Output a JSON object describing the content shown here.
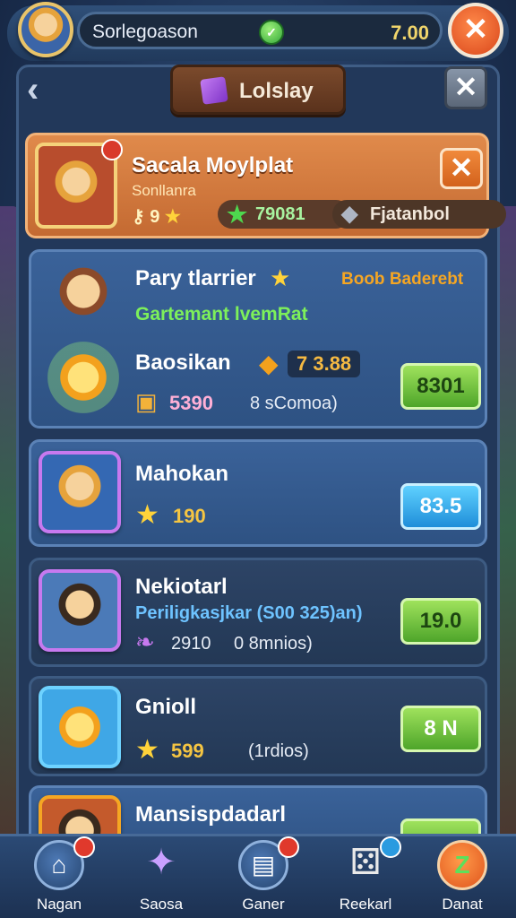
{
  "topbar": {
    "player_name": "Sorlegoason",
    "currency_value": "7.00"
  },
  "header": {
    "title": "Lolslay"
  },
  "featured": {
    "title": "Sacala Moylplat",
    "subtitle": "Sonllanra",
    "stat_left": "9",
    "stat_mid": "79081",
    "stat_right": "Fjatanbol"
  },
  "items": [
    {
      "name": "Pary tlarrier",
      "tag": "Boob Baderebt",
      "subtitle": "Gartemant lvemRat",
      "reward_name": "Baosikan",
      "reward_value": "7 3.88",
      "stat": "5390",
      "note": "8 sComoa)",
      "price": "8301"
    },
    {
      "name": "Mahokan",
      "stat": "190",
      "price": "83.5"
    },
    {
      "name": "Nekiotarl",
      "subtitle": "Periligkasjkar (S00 325)an)",
      "stat": "2910",
      "note": "0  8mnios)",
      "price": "19.0"
    },
    {
      "name": "Gnioll",
      "stat": "599",
      "note": "(1rdios)",
      "price": "8 N"
    },
    {
      "name": "Mansispdadarl",
      "price": ""
    }
  ],
  "nav": [
    {
      "label": "Nagan",
      "icon": "home-icon"
    },
    {
      "label": "Saosa",
      "icon": "stars-icon"
    },
    {
      "label": "Ganer",
      "icon": "game-icon"
    },
    {
      "label": "Reekarl",
      "icon": "dice-icon"
    },
    {
      "label": "Danat",
      "icon": "refresh-icon"
    }
  ]
}
